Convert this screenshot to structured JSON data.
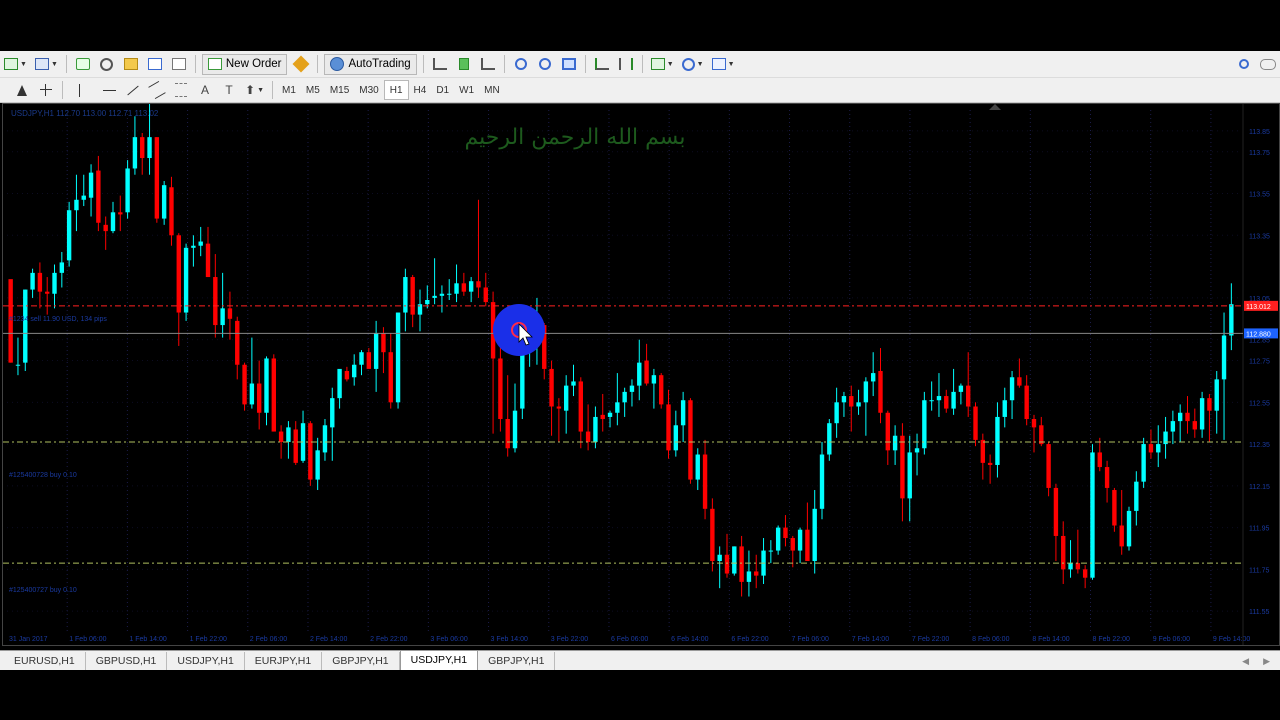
{
  "toolbar": {
    "new_order_label": "New Order",
    "autotrading_label": "AutoTrading",
    "timeframes": [
      "M1",
      "M5",
      "M15",
      "M30",
      "H1",
      "H4",
      "D1",
      "W1",
      "MN"
    ],
    "active_timeframe": "H1",
    "text_tool_label": "A",
    "text_label_tool_label": "T"
  },
  "chart": {
    "info_line": "USDJPY,H1  112.70 113.00 112.71 113.02",
    "line_labels": [
      "#1234 sell 11.90 USD, 134 pips",
      "#125400728 buy 0.10",
      "#125400727 buy 0.10"
    ],
    "colors": {
      "background": "#000000",
      "bull_candle": "#00ffff",
      "bear_candle": "#ff0000",
      "grid": "#1c1c4a",
      "order_line": "#ff2020",
      "level_line": "#b0c060"
    },
    "watermark": "بسم الله الرحمن الرحيم"
  },
  "chart_data": {
    "type": "candlestick",
    "symbol": "USDJPY",
    "timeframe": "H1",
    "x_labels": [
      "31 Jan 2017",
      "1 Feb 06:00",
      "1 Feb 14:00",
      "1 Feb 22:00",
      "2 Feb 06:00",
      "2 Feb 14:00",
      "2 Feb 22:00",
      "3 Feb 06:00",
      "3 Feb 14:00",
      "3 Feb 22:00",
      "6 Feb 06:00",
      "6 Feb 14:00",
      "6 Feb 22:00",
      "7 Feb 06:00",
      "7 Feb 14:00",
      "7 Feb 22:00",
      "8 Feb 06:00",
      "8 Feb 14:00",
      "8 Feb 22:00",
      "9 Feb 06:00",
      "9 Feb 14:00"
    ],
    "y_labels": [
      "113.85",
      "113.75",
      "113.55",
      "113.35",
      "113.05",
      "112.85",
      "112.75",
      "112.55",
      "112.35",
      "112.15",
      "111.95",
      "111.75",
      "111.55"
    ],
    "ylim": [
      111.45,
      113.95
    ],
    "price_tags": [
      {
        "value": 113.012,
        "label": "113.012",
        "color": "#ff2020"
      },
      {
        "value": 112.88,
        "label": "112.880",
        "color": "#1e64ff"
      }
    ],
    "levels": [
      {
        "value": 113.012,
        "style": "order",
        "color": "#ff2020"
      },
      {
        "value": 112.88,
        "style": "bid",
        "color": "#888888"
      },
      {
        "value": 112.36,
        "style": "level",
        "color": "#b0c060"
      },
      {
        "value": 111.78,
        "style": "level",
        "color": "#b0c060"
      }
    ],
    "candles": [
      [
        113.14,
        113.12,
        112.74,
        112.74
      ],
      [
        112.73,
        112.86,
        112.68,
        112.73
      ],
      [
        112.74,
        113.09,
        112.7,
        113.09
      ],
      [
        113.09,
        113.19,
        113.05,
        113.17
      ],
      [
        113.17,
        113.22,
        113.0,
        113.08
      ],
      [
        113.08,
        113.15,
        112.97,
        113.07
      ],
      [
        113.07,
        113.21,
        113.0,
        113.17
      ],
      [
        113.17,
        113.27,
        113.1,
        113.22
      ],
      [
        113.23,
        113.51,
        113.2,
        113.47
      ],
      [
        113.47,
        113.64,
        113.37,
        113.52
      ],
      [
        113.52,
        113.64,
        113.49,
        113.54
      ],
      [
        113.53,
        113.69,
        113.44,
        113.65
      ],
      [
        113.66,
        113.73,
        113.37,
        113.41
      ],
      [
        113.4,
        113.44,
        113.28,
        113.37
      ],
      [
        113.37,
        113.51,
        113.36,
        113.46
      ],
      [
        113.46,
        113.54,
        113.37,
        113.45
      ],
      [
        113.46,
        113.71,
        113.43,
        113.67
      ],
      [
        113.67,
        113.92,
        113.64,
        113.82
      ],
      [
        113.82,
        113.84,
        113.64,
        113.72
      ],
      [
        113.72,
        114.01,
        113.64,
        113.82
      ],
      [
        113.82,
        113.82,
        113.41,
        113.43
      ],
      [
        113.43,
        113.61,
        113.4,
        113.59
      ],
      [
        113.58,
        113.63,
        113.3,
        113.35
      ],
      [
        113.35,
        113.36,
        112.82,
        112.98
      ],
      [
        112.98,
        113.31,
        112.94,
        113.29
      ],
      [
        113.29,
        113.35,
        113.2,
        113.3
      ],
      [
        113.3,
        113.39,
        113.25,
        113.32
      ],
      [
        113.31,
        113.39,
        113.15,
        113.15
      ],
      [
        113.15,
        113.26,
        112.86,
        112.92
      ],
      [
        112.92,
        113.17,
        112.86,
        113.0
      ],
      [
        113.0,
        113.08,
        112.85,
        112.95
      ],
      [
        112.94,
        112.96,
        112.66,
        112.73
      ],
      [
        112.73,
        112.74,
        112.51,
        112.54
      ],
      [
        112.54,
        112.86,
        112.52,
        112.64
      ],
      [
        112.64,
        112.75,
        112.42,
        112.5
      ],
      [
        112.5,
        112.77,
        112.44,
        112.76
      ],
      [
        112.76,
        112.78,
        112.41,
        112.41
      ],
      [
        112.41,
        112.44,
        112.28,
        112.36
      ],
      [
        112.36,
        112.46,
        112.28,
        112.43
      ],
      [
        112.42,
        112.46,
        112.25,
        112.26
      ],
      [
        112.27,
        112.51,
        112.26,
        112.45
      ],
      [
        112.45,
        112.46,
        112.15,
        112.18
      ],
      [
        112.18,
        112.38,
        112.13,
        112.32
      ],
      [
        112.31,
        112.47,
        112.27,
        112.44
      ],
      [
        112.43,
        112.62,
        112.27,
        112.57
      ],
      [
        112.57,
        112.7,
        112.52,
        112.71
      ],
      [
        112.7,
        112.72,
        112.65,
        112.66
      ],
      [
        112.67,
        112.78,
        112.63,
        112.73
      ],
      [
        112.73,
        112.8,
        112.68,
        112.79
      ],
      [
        112.79,
        112.81,
        112.72,
        112.71
      ],
      [
        112.71,
        112.94,
        112.6,
        112.88
      ],
      [
        112.88,
        112.91,
        112.69,
        112.79
      ],
      [
        112.79,
        112.88,
        112.52,
        112.55
      ],
      [
        112.55,
        112.98,
        112.52,
        112.98
      ],
      [
        112.98,
        113.19,
        112.89,
        113.15
      ],
      [
        113.15,
        113.16,
        112.91,
        112.97
      ],
      [
        112.97,
        113.09,
        112.89,
        113.02
      ],
      [
        113.02,
        113.11,
        113.0,
        113.04
      ],
      [
        113.05,
        113.24,
        113.02,
        113.06
      ],
      [
        113.06,
        113.11,
        112.98,
        113.07
      ],
      [
        113.07,
        113.14,
        113.04,
        113.07
      ],
      [
        113.07,
        113.21,
        113.03,
        113.12
      ],
      [
        113.12,
        113.17,
        113.06,
        113.08
      ],
      [
        113.08,
        113.15,
        113.03,
        113.13
      ],
      [
        113.13,
        113.52,
        113.05,
        113.1
      ],
      [
        113.1,
        113.17,
        113.01,
        113.03
      ],
      [
        113.03,
        113.08,
        112.4,
        112.76
      ],
      [
        112.76,
        112.98,
        112.41,
        112.47
      ],
      [
        112.47,
        112.68,
        112.29,
        112.33
      ],
      [
        112.33,
        112.64,
        112.31,
        112.51
      ],
      [
        112.52,
        112.86,
        112.47,
        112.8
      ],
      [
        112.79,
        112.99,
        112.72,
        112.89
      ],
      [
        112.88,
        113.05,
        112.73,
        112.92
      ],
      [
        112.92,
        112.93,
        112.66,
        112.71
      ],
      [
        112.71,
        112.75,
        112.39,
        112.53
      ],
      [
        112.53,
        112.57,
        112.36,
        112.52
      ],
      [
        112.51,
        112.68,
        112.4,
        112.63
      ],
      [
        112.63,
        112.73,
        112.58,
        112.65
      ],
      [
        112.65,
        112.67,
        112.33,
        112.41
      ],
      [
        112.41,
        112.54,
        112.32,
        112.36
      ],
      [
        112.36,
        112.53,
        112.33,
        112.48
      ],
      [
        112.49,
        112.59,
        112.41,
        112.47
      ],
      [
        112.48,
        112.51,
        112.43,
        112.5
      ],
      [
        112.5,
        112.69,
        112.44,
        112.55
      ],
      [
        112.55,
        112.62,
        112.48,
        112.6
      ],
      [
        112.6,
        112.66,
        112.53,
        112.63
      ],
      [
        112.63,
        112.85,
        112.56,
        112.74
      ],
      [
        112.75,
        112.83,
        112.63,
        112.64
      ],
      [
        112.64,
        112.71,
        112.52,
        112.68
      ],
      [
        112.68,
        112.69,
        112.52,
        112.54
      ],
      [
        112.54,
        112.61,
        112.28,
        112.32
      ],
      [
        112.32,
        112.51,
        112.29,
        112.44
      ],
      [
        112.44,
        112.6,
        112.36,
        112.56
      ],
      [
        112.56,
        112.57,
        112.16,
        112.18
      ],
      [
        112.18,
        112.33,
        112.13,
        112.3
      ],
      [
        112.3,
        112.37,
        111.99,
        112.04
      ],
      [
        112.04,
        112.09,
        111.74,
        111.79
      ],
      [
        111.79,
        111.86,
        111.66,
        111.82
      ],
      [
        111.82,
        111.92,
        111.71,
        111.73
      ],
      [
        111.73,
        111.86,
        111.72,
        111.86
      ],
      [
        111.86,
        111.91,
        111.62,
        111.69
      ],
      [
        111.69,
        111.84,
        111.62,
        111.74
      ],
      [
        111.74,
        111.82,
        111.66,
        111.72
      ],
      [
        111.72,
        111.9,
        111.68,
        111.84
      ],
      [
        111.84,
        111.89,
        111.78,
        111.84
      ],
      [
        111.84,
        111.96,
        111.82,
        111.95
      ],
      [
        111.95,
        112.01,
        111.86,
        111.9
      ],
      [
        111.9,
        111.91,
        111.76,
        111.84
      ],
      [
        111.84,
        111.95,
        111.78,
        111.94
      ],
      [
        111.94,
        112.07,
        111.79,
        111.79
      ],
      [
        111.79,
        112.13,
        111.73,
        112.04
      ],
      [
        112.04,
        112.36,
        111.99,
        112.3
      ],
      [
        112.3,
        112.47,
        112.27,
        112.45
      ],
      [
        112.45,
        112.62,
        112.38,
        112.55
      ],
      [
        112.55,
        112.6,
        112.48,
        112.58
      ],
      [
        112.58,
        112.63,
        112.41,
        112.53
      ],
      [
        112.53,
        112.61,
        112.49,
        112.55
      ],
      [
        112.55,
        112.67,
        112.39,
        112.65
      ],
      [
        112.65,
        112.79,
        112.58,
        112.69
      ],
      [
        112.7,
        112.81,
        112.45,
        112.5
      ],
      [
        112.5,
        112.51,
        112.25,
        112.32
      ],
      [
        112.32,
        112.44,
        112.25,
        112.39
      ],
      [
        112.39,
        112.45,
        111.98,
        112.09
      ],
      [
        112.09,
        112.39,
        111.98,
        112.31
      ],
      [
        112.31,
        112.4,
        112.2,
        112.33
      ],
      [
        112.33,
        112.6,
        112.3,
        112.56
      ],
      [
        112.56,
        112.65,
        112.51,
        112.56
      ],
      [
        112.56,
        112.69,
        112.48,
        112.58
      ],
      [
        112.58,
        112.61,
        112.5,
        112.52
      ],
      [
        112.52,
        112.71,
        112.49,
        112.6
      ],
      [
        112.6,
        112.64,
        112.54,
        112.63
      ],
      [
        112.63,
        112.79,
        112.48,
        112.53
      ],
      [
        112.53,
        112.55,
        112.34,
        112.37
      ],
      [
        112.37,
        112.4,
        112.18,
        112.26
      ],
      [
        112.26,
        112.3,
        112.16,
        112.25
      ],
      [
        112.25,
        112.55,
        112.19,
        112.48
      ],
      [
        112.48,
        112.62,
        112.43,
        112.56
      ],
      [
        112.56,
        112.7,
        112.47,
        112.67
      ],
      [
        112.67,
        112.76,
        112.62,
        112.63
      ],
      [
        112.63,
        112.68,
        112.44,
        112.47
      ],
      [
        112.47,
        112.49,
        112.31,
        112.43
      ],
      [
        112.44,
        112.48,
        112.34,
        112.35
      ],
      [
        112.35,
        112.36,
        112.1,
        112.14
      ],
      [
        112.14,
        112.16,
        111.79,
        111.91
      ],
      [
        111.91,
        111.98,
        111.68,
        111.75
      ],
      [
        111.75,
        111.89,
        111.71,
        111.78
      ],
      [
        111.78,
        111.94,
        111.73,
        111.75
      ],
      [
        111.75,
        111.77,
        111.66,
        111.71
      ],
      [
        111.71,
        112.35,
        111.7,
        112.31
      ],
      [
        112.31,
        112.38,
        112.22,
        112.24
      ],
      [
        112.24,
        112.27,
        112.07,
        112.14
      ],
      [
        112.13,
        112.14,
        111.93,
        111.96
      ],
      [
        111.96,
        112.13,
        111.82,
        111.86
      ],
      [
        111.86,
        112.05,
        111.84,
        112.03
      ],
      [
        112.03,
        112.22,
        111.96,
        112.17
      ],
      [
        112.17,
        112.38,
        112.14,
        112.35
      ],
      [
        112.35,
        112.42,
        112.28,
        112.31
      ],
      [
        112.31,
        112.44,
        112.24,
        112.35
      ],
      [
        112.35,
        112.48,
        112.28,
        112.41
      ],
      [
        112.41,
        112.51,
        112.35,
        112.46
      ],
      [
        112.46,
        112.54,
        112.36,
        112.5
      ],
      [
        112.5,
        112.58,
        112.4,
        112.46
      ],
      [
        112.46,
        112.52,
        112.38,
        112.42
      ],
      [
        112.42,
        112.6,
        112.38,
        112.57
      ],
      [
        112.57,
        112.59,
        112.36,
        112.51
      ],
      [
        112.51,
        112.7,
        112.4,
        112.66
      ],
      [
        112.66,
        112.98,
        112.37,
        112.87
      ],
      [
        112.87,
        113.12,
        112.8,
        113.02
      ]
    ]
  },
  "tabs": [
    "EURUSD,H1",
    "GBPUSD,H1",
    "USDJPY,H1",
    "EURJPY,H1",
    "GBPJPY,H1",
    "USDJPY,H1",
    "GBPJPY,H1"
  ],
  "active_tab_index": 5
}
